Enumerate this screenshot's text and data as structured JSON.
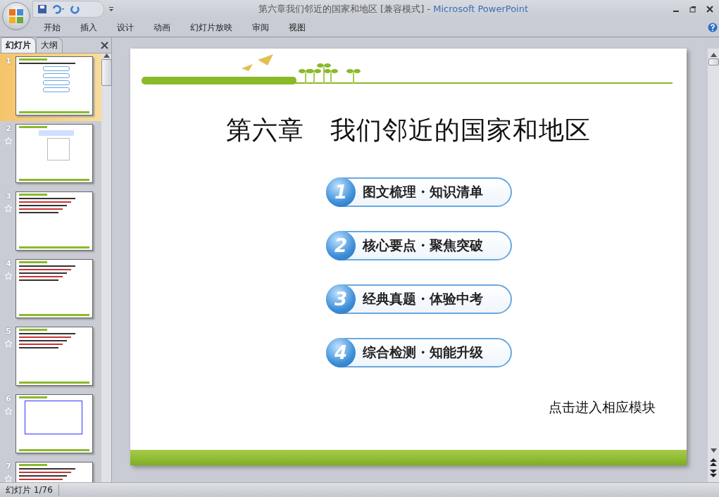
{
  "window": {
    "title": "第六章我们邻近的国家和地区 [兼容模式]",
    "separator": "-",
    "app_name": "Microsoft PowerPoint"
  },
  "ribbon_tabs": [
    {
      "label": "开始",
      "selected": false
    },
    {
      "label": "插入",
      "selected": false
    },
    {
      "label": "设计",
      "selected": false
    },
    {
      "label": "动画",
      "selected": false
    },
    {
      "label": "幻灯片放映",
      "selected": false
    },
    {
      "label": "审阅",
      "selected": false
    },
    {
      "label": "视图",
      "selected": false
    }
  ],
  "panel_tabs": [
    {
      "label": "幻灯片",
      "selected": true
    },
    {
      "label": "大纲",
      "selected": false
    }
  ],
  "thumbnails": [
    {
      "number": "1",
      "selected": true,
      "animated": false,
      "kind": "menu"
    },
    {
      "number": "2",
      "selected": false,
      "animated": true,
      "kind": "map"
    },
    {
      "number": "3",
      "selected": false,
      "animated": true,
      "kind": "text"
    },
    {
      "number": "4",
      "selected": false,
      "animated": true,
      "kind": "text"
    },
    {
      "number": "5",
      "selected": false,
      "animated": true,
      "kind": "text"
    },
    {
      "number": "6",
      "selected": false,
      "animated": true,
      "kind": "diagram"
    },
    {
      "number": "7",
      "selected": false,
      "animated": true,
      "kind": "text"
    }
  ],
  "slide": {
    "title": "第六章　我们邻近的国家和地区",
    "menu": [
      {
        "number": "1",
        "label": "图文梳理・知识清单"
      },
      {
        "number": "2",
        "label": "核心要点・聚焦突破"
      },
      {
        "number": "3",
        "label": "经典真题・体验中考"
      },
      {
        "number": "4",
        "label": "综合检测・知能升级"
      }
    ],
    "hint": "点击进入相应模块"
  },
  "status_bar": {
    "slide_info": "幻灯片 1/76"
  }
}
